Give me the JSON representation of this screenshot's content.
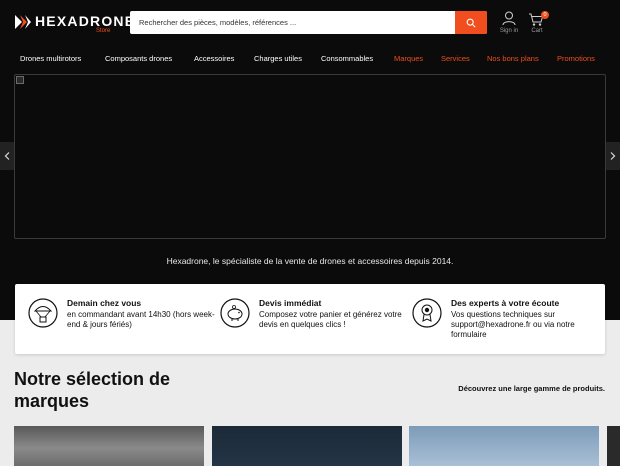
{
  "header": {
    "logo_text": "HEXADRONE",
    "logo_sub": "Store",
    "search_placeholder": "Rechercher des pièces, modèles, références ...",
    "signin_label": "Sign in",
    "cart_label": "Cart",
    "cart_count": "0",
    "accent_color": "#f04e1e"
  },
  "nav": {
    "items": [
      {
        "label": "Drones multirotors"
      },
      {
        "label": "Composants drones"
      },
      {
        "label": "Accessoires"
      },
      {
        "label": "Charges utiles"
      },
      {
        "label": "Consommables"
      },
      {
        "label": "Marques"
      },
      {
        "label": "Services"
      },
      {
        "label": "Nos bons plans"
      },
      {
        "label": "Promotions"
      }
    ]
  },
  "hero": {
    "tagline": "Hexadrone, le spécialiste de la vente de drones et accessoires depuis 2014."
  },
  "features": [
    {
      "icon": "parachute-box-icon",
      "title": "Demain chez vous",
      "text": "en commandant avant 14h30 (hors week-end & jours fériés)"
    },
    {
      "icon": "piggy-bank-icon",
      "title": "Devis immédiat",
      "text": "Composez votre panier et générez votre devis en quelques clics !"
    },
    {
      "icon": "expert-badge-icon",
      "title": "Des experts à votre écoute",
      "text": "Vos questions techniques sur support@hexadrone.fr ou via notre formulaire"
    }
  ],
  "brands": {
    "title": "Notre sélection de marques",
    "subtitle": "Découvrez une large gamme de produits."
  }
}
